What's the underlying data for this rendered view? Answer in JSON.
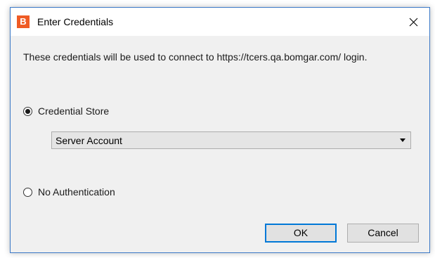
{
  "dialog": {
    "app_icon_letter": "B",
    "title": "Enter Credentials",
    "message": "These credentials will be used to connect to https://tcers.qa.bomgar.com/ login.",
    "options": [
      {
        "label": "Credential Store",
        "selected": true
      },
      {
        "label": "No Authentication",
        "selected": false
      }
    ],
    "credential_select": {
      "value": "Server Account"
    },
    "buttons": {
      "ok": "OK",
      "cancel": "Cancel"
    }
  },
  "colors": {
    "accent": "#0078d7",
    "app_icon": "#ef5b25",
    "dialog_border": "#3b79c7",
    "dialog_bg": "#f0f0f0"
  },
  "icons": [
    "app-icon",
    "close-icon",
    "dropdown-arrow-icon"
  ]
}
